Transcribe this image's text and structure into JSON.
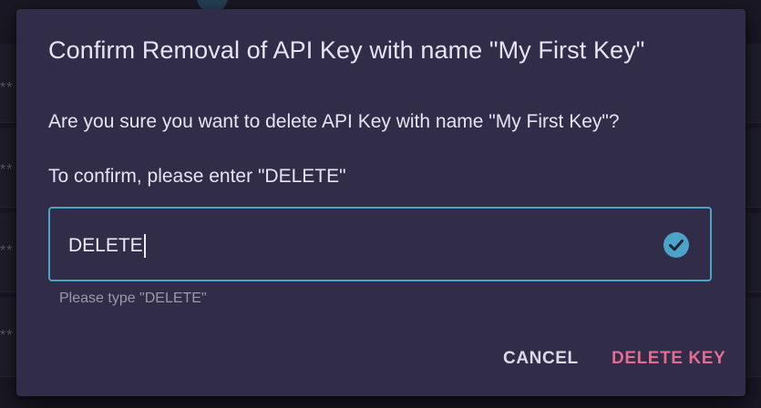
{
  "background": {
    "masked_value": "**",
    "rows": 4
  },
  "dialog": {
    "title": "Confirm Removal of API Key with name \"My First Key\"",
    "question": "Are you sure you want to delete API Key with name \"My First Key\"?",
    "instruction": "To confirm, please enter \"DELETE\"",
    "input": {
      "value": "DELETE",
      "hint": "Please type \"DELETE\"",
      "valid": true,
      "status_icon": "check-circle-icon"
    },
    "actions": {
      "cancel_label": "CANCEL",
      "delete_label": "DELETE KEY"
    }
  },
  "colors": {
    "dialog_background": "#312c47",
    "input_border": "#4ca3c9",
    "valid_icon": "#4ca3c9",
    "delete_accent": "#e36c93",
    "cancel_text": "#ddd9ec"
  }
}
